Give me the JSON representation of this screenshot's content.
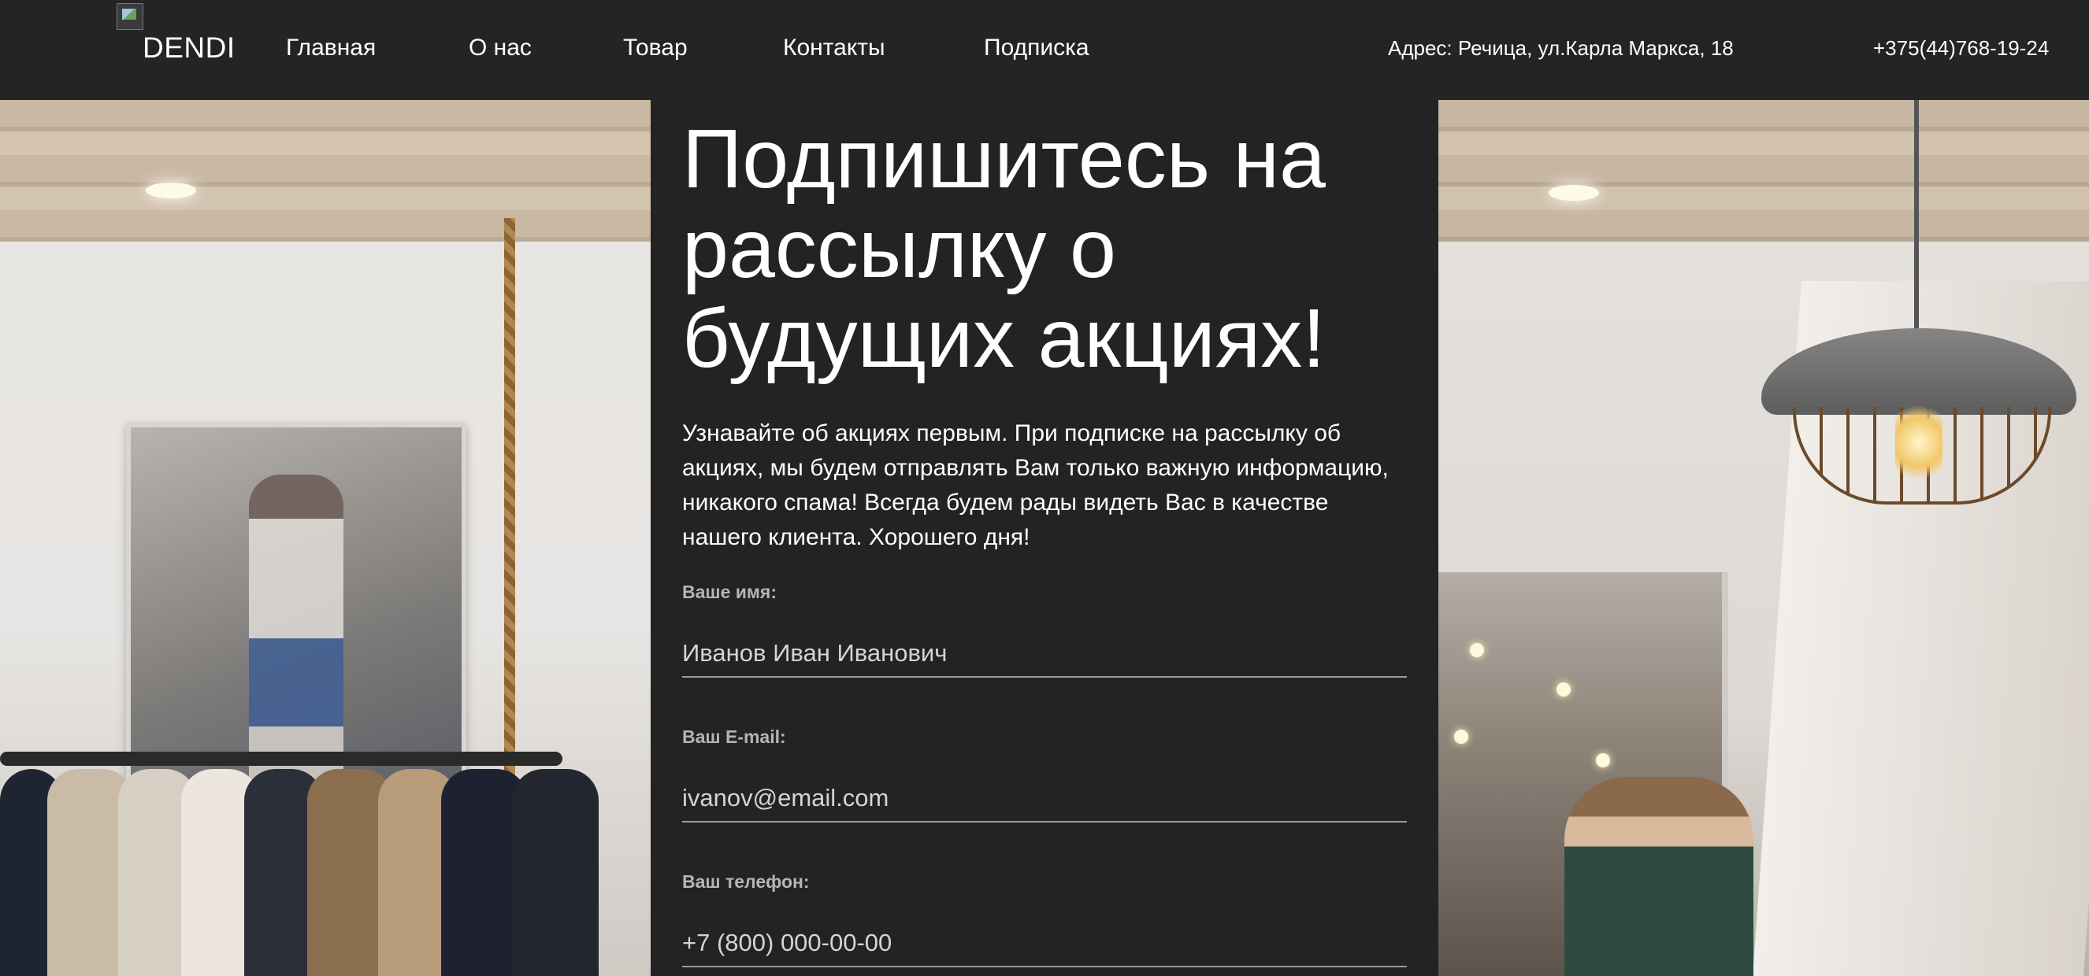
{
  "header": {
    "brand": "DENDI",
    "nav": [
      {
        "label": "Главная"
      },
      {
        "label": "О нас"
      },
      {
        "label": "Товар"
      },
      {
        "label": "Контакты"
      },
      {
        "label": "Подписка"
      }
    ],
    "address": "Адрес: Речица, ул.Карла Маркса, 18",
    "phone": "+375(44)768-19-24"
  },
  "subscribe": {
    "title": "Подпишитесь на рассылку о будущих акциях!",
    "description": "Узнавайте об акциях первым. При подписке на рассылку об акциях, мы будем отправлять Вам только важную информацию, никакого спама! Всегда будем рады видеть Вас в качестве нашего клиента. Хорошего дня!",
    "fields": [
      {
        "label": "Ваше имя:",
        "placeholder": "Иванов Иван Иванович"
      },
      {
        "label": "Ваш E-mail:",
        "placeholder": "ivanov@email.com"
      },
      {
        "label": "Ваш телефон:",
        "placeholder": "+7 (800) 000-00-00"
      }
    ]
  },
  "colors": {
    "header_bg": "#242424",
    "panel_bg": "#232323",
    "text": "#ffffff",
    "label": "#b5b5b5"
  }
}
